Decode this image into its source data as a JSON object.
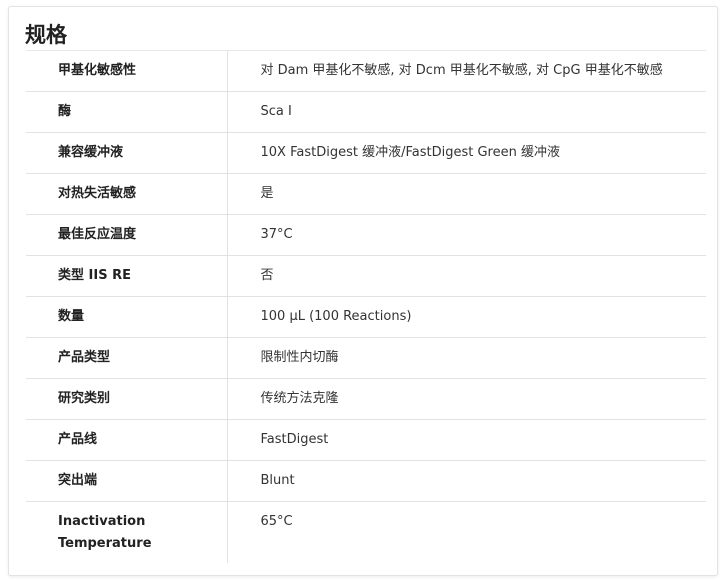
{
  "section": {
    "title": "规格"
  },
  "specs": {
    "rows": [
      {
        "label": "甲基化敏感性",
        "value": "对 Dam 甲基化不敏感, 对 Dcm 甲基化不敏感, 对 CpG 甲基化不敏感"
      },
      {
        "label": "酶",
        "value": "Sca I"
      },
      {
        "label": "兼容缓冲液",
        "value": "10X FastDigest 缓冲液/FastDigest Green 缓冲液"
      },
      {
        "label": "对热失活敏感",
        "value": "是"
      },
      {
        "label": "最佳反应温度",
        "value": "37°C"
      },
      {
        "label": "类型 IIS RE",
        "value": "否"
      },
      {
        "label": "数量",
        "value": "100 µL (100 Reactions)"
      },
      {
        "label": "产品类型",
        "value": "限制性内切酶"
      },
      {
        "label": "研究类别",
        "value": "传统方法克隆"
      },
      {
        "label": "产品线",
        "value": "FastDigest"
      },
      {
        "label": "突出端",
        "value": "Blunt"
      },
      {
        "label": "Inactivation Temperature",
        "value": "65°C"
      }
    ]
  }
}
